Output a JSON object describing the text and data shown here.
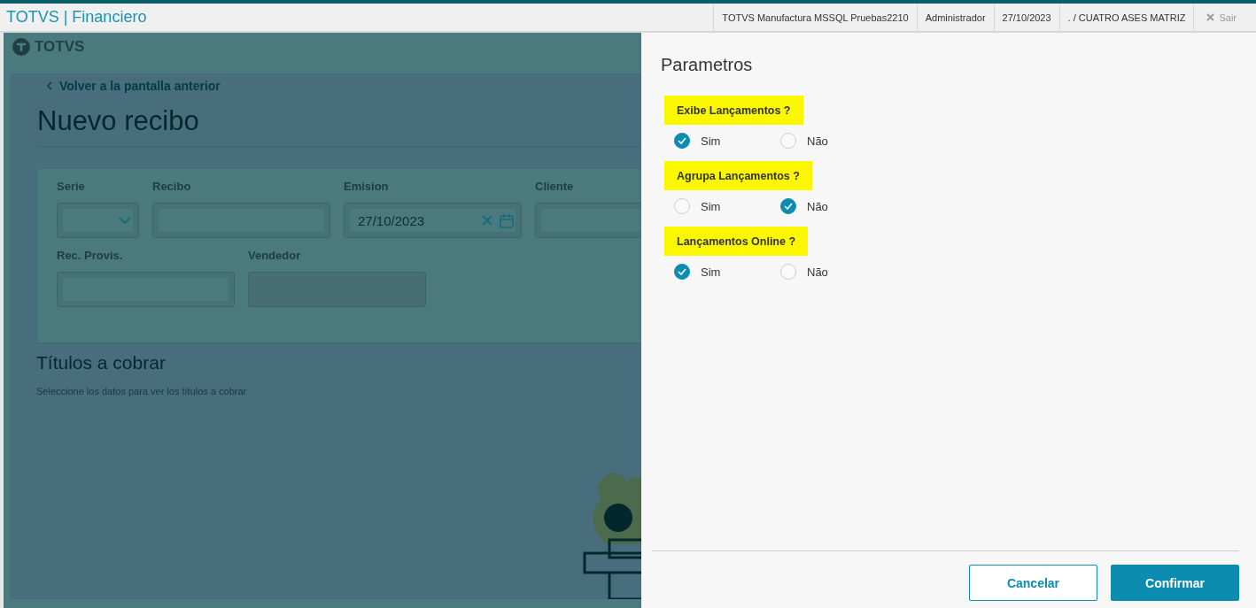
{
  "header": {
    "app_title": "TOTVS | Financiero",
    "info": [
      "TOTVS Manufactura MSSQL Pruebas2210",
      "Administrador",
      "27/10/2023",
      ". / CUATRO ASES MATRIZ"
    ],
    "exit_label": "Sair"
  },
  "background_page": {
    "logo": "TOTVS",
    "back_link": "Volver a la pantalla anterior",
    "title": "Nuevo recibo",
    "field_rows": [
      [
        {
          "label": "Serie",
          "kind": "select"
        },
        {
          "label": "Recibo",
          "kind": "text"
        },
        {
          "label": "Emision",
          "kind": "date",
          "value": "27/10/2023"
        },
        {
          "label": "Cliente",
          "kind": "text"
        }
      ],
      [
        {
          "label": "Rec. Provis.",
          "kind": "text"
        },
        {
          "label": "Vendedor",
          "kind": "readonly"
        }
      ]
    ],
    "section_title": "Títulos a cobrar",
    "section_hint": "Seleccione los datos para ver los títulos a cobrar"
  },
  "drawer": {
    "title": "Parametros",
    "questions": [
      {
        "label": "Exibe Lançamentos ?",
        "options": [
          {
            "label": "Sim",
            "selected": true
          },
          {
            "label": "Não",
            "selected": false
          }
        ]
      },
      {
        "label": "Agrupa Lançamentos ?",
        "options": [
          {
            "label": "Sim",
            "selected": false
          },
          {
            "label": "Não",
            "selected": true
          }
        ]
      },
      {
        "label": "Lançamentos Online ?",
        "options": [
          {
            "label": "Sim",
            "selected": true
          },
          {
            "label": "Não",
            "selected": false
          }
        ]
      }
    ],
    "buttons": [
      {
        "label": "Cancelar",
        "kind": "secondary"
      },
      {
        "label": "Confirmar",
        "kind": "primary"
      }
    ]
  }
}
